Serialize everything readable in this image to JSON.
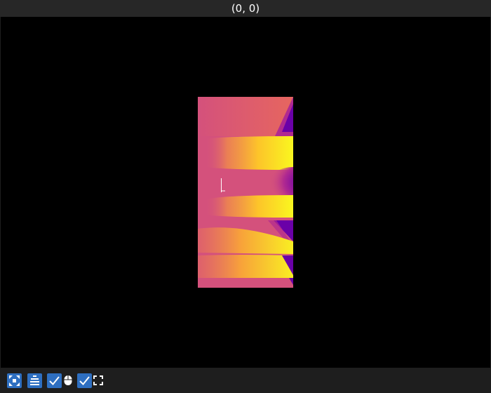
{
  "window": {
    "title": "(0, 0)"
  },
  "colors": {
    "titlebar_bg": "#272727",
    "canvas_bg": "#000000",
    "toolbar_bg": "#1e1e1e",
    "button_blue": "#2e6fc1",
    "colormap": "plasma"
  },
  "toolbar": {
    "items": [
      {
        "icon": "crosshair-icon",
        "type": "button"
      },
      {
        "icon": "align-center-icon",
        "type": "button"
      },
      {
        "icon": "checkbox-checked-icon",
        "type": "toggle",
        "checked": true
      },
      {
        "icon": "mouse-icon",
        "type": "indicator"
      },
      {
        "icon": "checkbox-checked-icon",
        "type": "toggle",
        "checked": true
      },
      {
        "icon": "fullscreen-icon",
        "type": "button"
      }
    ]
  }
}
